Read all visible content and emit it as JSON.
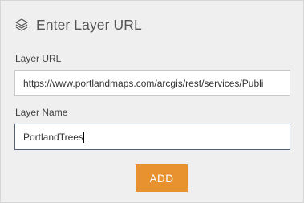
{
  "header": {
    "title": "Enter Layer URL",
    "icon": "layers-icon"
  },
  "layer_url": {
    "label": "Layer URL",
    "value": "https://www.portlandmaps.com/arcgis/rest/services/Publi"
  },
  "layer_name": {
    "label": "Layer Name",
    "value": "PortlandTrees"
  },
  "add_button": {
    "label": "ADD"
  },
  "colors": {
    "accent": "#e8912f",
    "focus_border": "#52607a",
    "background": "#efefef"
  }
}
